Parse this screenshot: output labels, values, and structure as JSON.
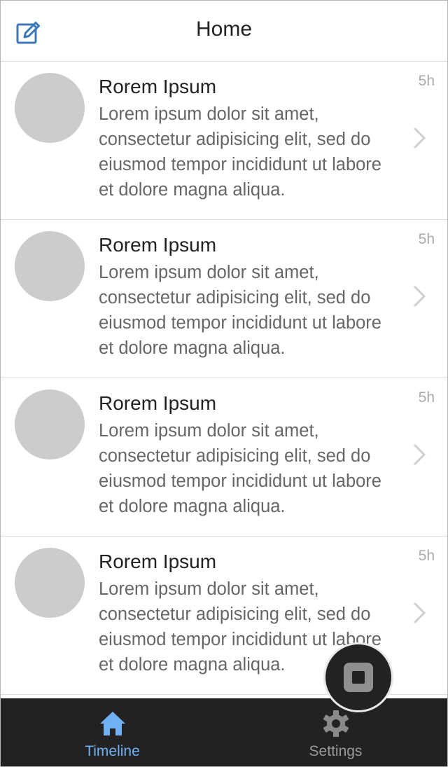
{
  "header": {
    "title": "Home",
    "compose_icon": "edit-icon"
  },
  "feed": {
    "items": [
      {
        "title": "Rorem Ipsum",
        "body": "Lorem ipsum dolor sit amet, consectetur adipisicing elit, sed do eiusmod tempor incididunt ut labore et dolore magna aliqua.",
        "time": "5h"
      },
      {
        "title": "Rorem Ipsum",
        "body": "Lorem ipsum dolor sit amet, consectetur adipisicing elit, sed do eiusmod tempor incididunt ut labore et dolore magna aliqua.",
        "time": "5h"
      },
      {
        "title": "Rorem Ipsum",
        "body": "Lorem ipsum dolor sit amet, consectetur adipisicing elit, sed do eiusmod tempor incididunt ut labore et dolore magna aliqua.",
        "time": "5h"
      },
      {
        "title": "Rorem Ipsum",
        "body": "Lorem ipsum dolor sit amet, consectetur adipisicing elit, sed do eiusmod tempor incididunt ut labore et dolore magna aliqua.",
        "time": "5h"
      }
    ]
  },
  "tabbar": {
    "tabs": [
      {
        "label": "Timeline",
        "icon": "home-icon",
        "active": true
      },
      {
        "label": "Settings",
        "icon": "gear-icon",
        "active": false
      }
    ]
  },
  "fab": {
    "icon": "stop-icon"
  },
  "colors": {
    "accent": "#6fb1f3",
    "compose_icon": "#3a78b8",
    "tabbar_bg": "#222222",
    "avatar": "#cccccc",
    "inactive_tab": "#9a9a9a"
  }
}
